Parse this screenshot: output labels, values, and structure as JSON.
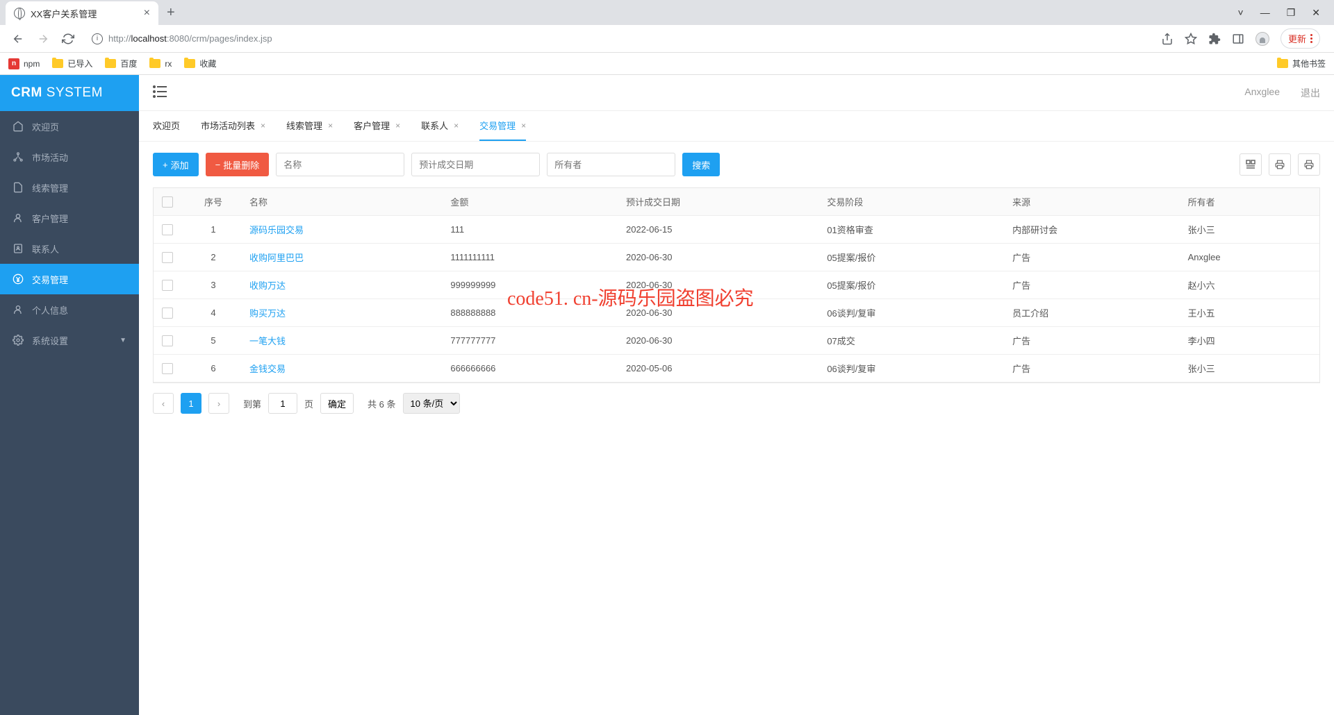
{
  "browser": {
    "tab_title": "XX客户关系管理",
    "url_prefix": "http://",
    "url_host": "localhost",
    "url_port": ":8080",
    "url_path": "/crm/pages/index.jsp",
    "update_label": "更新",
    "other_bookmarks": "其他书签",
    "bookmarks": [
      {
        "label": "npm",
        "type": "red"
      },
      {
        "label": "已导入",
        "type": "folder"
      },
      {
        "label": "百度",
        "type": "folder"
      },
      {
        "label": "rx",
        "type": "folder"
      },
      {
        "label": "收藏",
        "type": "folder"
      }
    ]
  },
  "logo": {
    "bold": "CRM",
    "thin": "SYSTEM"
  },
  "topbar": {
    "user": "Anxglee",
    "logout": "退出"
  },
  "sidebar": [
    {
      "label": "欢迎页",
      "icon": "home"
    },
    {
      "label": "市场活动",
      "icon": "networking"
    },
    {
      "label": "线索管理",
      "icon": "lead"
    },
    {
      "label": "客户管理",
      "icon": "person"
    },
    {
      "label": "联系人",
      "icon": "address"
    },
    {
      "label": "交易管理",
      "icon": "money",
      "active": true
    },
    {
      "label": "个人信息",
      "icon": "account"
    },
    {
      "label": "系统设置",
      "icon": "gear",
      "expandable": true
    }
  ],
  "tabs": [
    {
      "label": "欢迎页",
      "closable": false
    },
    {
      "label": "市场活动列表",
      "closable": true
    },
    {
      "label": "线索管理",
      "closable": true
    },
    {
      "label": "客户管理",
      "closable": true
    },
    {
      "label": "联系人",
      "closable": true
    },
    {
      "label": "交易管理",
      "closable": true,
      "active": true
    }
  ],
  "toolbar": {
    "add_label": "添加",
    "delete_label": "批量删除",
    "search_label": "搜索",
    "name_placeholder": "名称",
    "date_placeholder": "预计成交日期",
    "owner_placeholder": "所有者"
  },
  "columns": [
    "序号",
    "名称",
    "金额",
    "预计成交日期",
    "交易阶段",
    "来源",
    "所有者"
  ],
  "rows": [
    {
      "num": "1",
      "name": "源码乐园交易",
      "amount": "111",
      "date": "2022-06-15",
      "stage": "01资格审查",
      "source": "内部研讨会",
      "owner": "张小三"
    },
    {
      "num": "2",
      "name": "收购阿里巴巴",
      "amount": "1111111111",
      "date": "2020-06-30",
      "stage": "05提案/报价",
      "source": "广告",
      "owner": "Anxglee"
    },
    {
      "num": "3",
      "name": "收购万达",
      "amount": "999999999",
      "date": "2020-06-30",
      "stage": "05提案/报价",
      "source": "广告",
      "owner": "赵小六"
    },
    {
      "num": "4",
      "name": "购买万达",
      "amount": "888888888",
      "date": "2020-06-30",
      "stage": "06谈判/复审",
      "source": "员工介绍",
      "owner": "王小五"
    },
    {
      "num": "5",
      "name": "一笔大钱",
      "amount": "777777777",
      "date": "2020-06-30",
      "stage": "07成交",
      "source": "广告",
      "owner": "李小四"
    },
    {
      "num": "6",
      "name": "金钱交易",
      "amount": "666666666",
      "date": "2020-05-06",
      "stage": "06谈判/复审",
      "source": "广告",
      "owner": "张小三"
    }
  ],
  "pagination": {
    "current": "1",
    "goto_label": "到第",
    "page_value": "1",
    "page_unit": "页",
    "confirm": "确定",
    "total": "共 6 条",
    "per_page": "10 条/页"
  },
  "watermark": "code51. cn-源码乐园盗图必究"
}
